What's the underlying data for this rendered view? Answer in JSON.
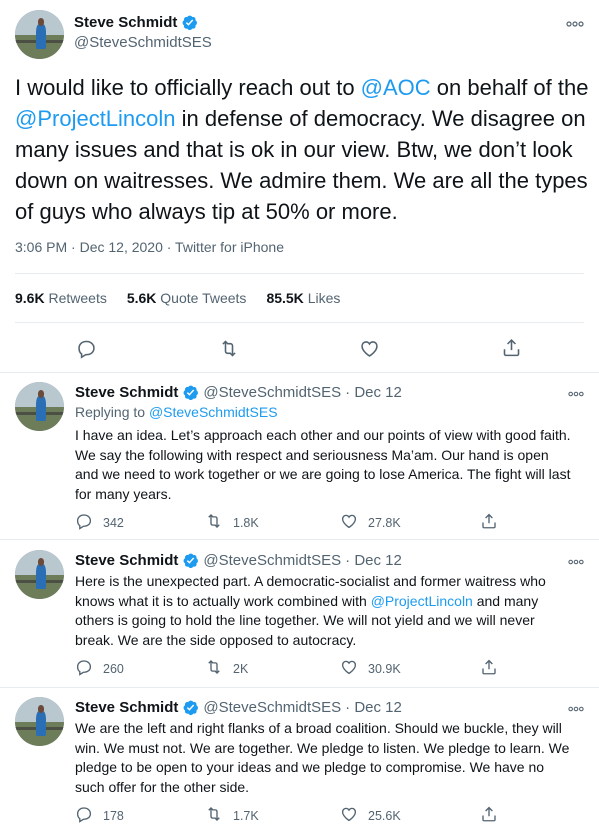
{
  "main_tweet": {
    "name": "Steve Schmidt",
    "handle": "@SteveSchmidtSES",
    "text_parts": [
      "I would like to officially reach out to ",
      "@AOC",
      " on behalf of the ",
      "@ProjectLincoln",
      " in defense of democracy. We disagree on many issues and that is ok in our view. Btw, we don’t look down on waitresses. We admire them. We are all the types of guys who always tip at 50% or more."
    ],
    "timestamp": "3:06 PM · Dec 12, 2020 · Twitter for iPhone",
    "stats": {
      "retweets_count": "9.6K",
      "retweets_label": "Retweets",
      "quotes_count": "5.6K",
      "quotes_label": "Quote Tweets",
      "likes_count": "85.5K",
      "likes_label": "Likes"
    }
  },
  "replies": [
    {
      "name": "Steve Schmidt",
      "handle": "@SteveSchmidtSES",
      "date": "· Dec 12",
      "replying_prefix": "Replying to ",
      "replying_handle": "@SteveSchmidtSES",
      "text": "I have an idea. Let’s approach each other and our points of view with good faith. We say the following with  respect and seriousness Ma’am. Our hand is open and we need to work together or we are going to lose America. The fight will last for many years.",
      "reply_count": "342",
      "retweet_count": "1.8K",
      "like_count": "27.8K"
    },
    {
      "name": "Steve Schmidt",
      "handle": "@SteveSchmidtSES",
      "date": "· Dec 12",
      "text_before": "Here is the unexpected part. A democratic-socialist and former waitress who knows what it is to actually work combined with ",
      "text_mention": "@ProjectLincoln",
      "text_after": " and many others is going to hold the line together. We will not yield and we will never break. We are the side opposed to autocracy.",
      "reply_count": "260",
      "retweet_count": "2K",
      "like_count": "30.9K"
    },
    {
      "name": "Steve Schmidt",
      "handle": "@SteveSchmidtSES",
      "date": "· Dec 12",
      "text": "We are the left and right flanks of a broad coalition. Should we buckle, they will win. We must not. We are together. We pledge to listen.  We pledge to learn. We pledge to be open to your ideas and we pledge to compromise. We have no such offer for the other side.",
      "reply_count": "178",
      "retweet_count": "1.7K",
      "like_count": "25.6K"
    }
  ],
  "colors": {
    "accent": "#1d9bf0",
    "muted": "#536471",
    "text": "#0f1419",
    "divider": "#e6ecf0"
  },
  "icons": [
    "verified-icon",
    "more-icon",
    "reply-icon",
    "retweet-icon",
    "like-icon",
    "share-icon"
  ]
}
